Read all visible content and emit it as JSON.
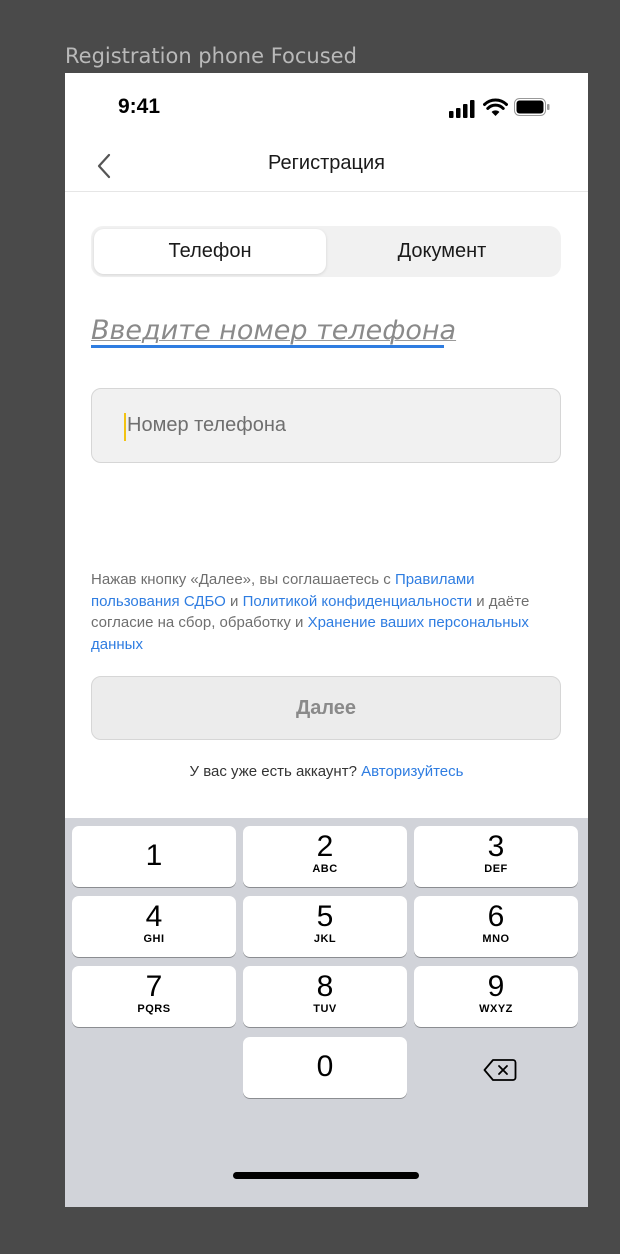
{
  "frame_label": "Registration phone Focused",
  "status_bar": {
    "time": "9:41"
  },
  "nav": {
    "title": "Регистрация"
  },
  "tabs": [
    {
      "label": "Телефон",
      "active": true
    },
    {
      "label": "Документ",
      "active": false
    }
  ],
  "form": {
    "heading": "Введите номер телефона",
    "phone_placeholder": "Номер телефона",
    "phone_value": ""
  },
  "consent": {
    "text_1": "Нажав кнопку «Далее», вы соглашаетесь с ",
    "link_1": "Правилами пользования СДБО",
    "text_2": " и ",
    "link_2": "Политикой конфиденциальности",
    "text_3": " и даёте согласие на сбор, обработку и ",
    "link_3": "Хранение ваших персональных данных"
  },
  "next_button": {
    "label": "Далее",
    "enabled": false
  },
  "login": {
    "text": "У вас уже есть аккаунт? ",
    "link": "Авторизуйтесь"
  },
  "keypad": [
    {
      "digit": "1",
      "letters": ""
    },
    {
      "digit": "2",
      "letters": "ABC"
    },
    {
      "digit": "3",
      "letters": "DEF"
    },
    {
      "digit": "4",
      "letters": "GHI"
    },
    {
      "digit": "5",
      "letters": "JKL"
    },
    {
      "digit": "6",
      "letters": "MNO"
    },
    {
      "digit": "7",
      "letters": "PQRS"
    },
    {
      "digit": "8",
      "letters": "TUV"
    },
    {
      "digit": "9",
      "letters": "WXYZ"
    },
    {
      "digit": "0",
      "letters": ""
    }
  ],
  "icons": {
    "back": "chevron-left-icon",
    "signal": "cellular-signal-icon",
    "wifi": "wifi-icon",
    "battery": "battery-icon",
    "delete": "backspace-icon"
  },
  "colors": {
    "accent": "#2f7de1",
    "caret": "#f2c313",
    "keyboard_bg": "#d1d3d9",
    "disabled_button": "#ececec"
  }
}
